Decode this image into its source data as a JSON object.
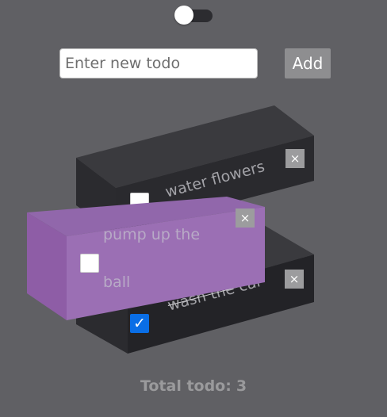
{
  "theme_toggle": {
    "state": "off"
  },
  "new_todo": {
    "placeholder": "Enter new todo",
    "value": ""
  },
  "add_button": {
    "label": "Add"
  },
  "todos": [
    {
      "label": "water flowers",
      "completed": false,
      "delete_label": "×",
      "check_mark": ""
    },
    {
      "label_line1": "pump up the",
      "label_line2": "ball",
      "completed": false,
      "delete_label": "×",
      "check_mark": ""
    },
    {
      "label": "wash the car",
      "completed": true,
      "delete_label": "×",
      "check_mark": "✓"
    }
  ],
  "footer": {
    "total_label": "Total todo:",
    "total_count": "3"
  },
  "colors": {
    "background": "#606064",
    "block_dark_front": "#232327",
    "block_dark_top": "#3a3a3e",
    "block_purple_front": "#9b6fb4",
    "block_purple_side": "#8e5da6",
    "checkbox_checked": "#0a6ee6",
    "delete_button": "#9c9c9e"
  }
}
